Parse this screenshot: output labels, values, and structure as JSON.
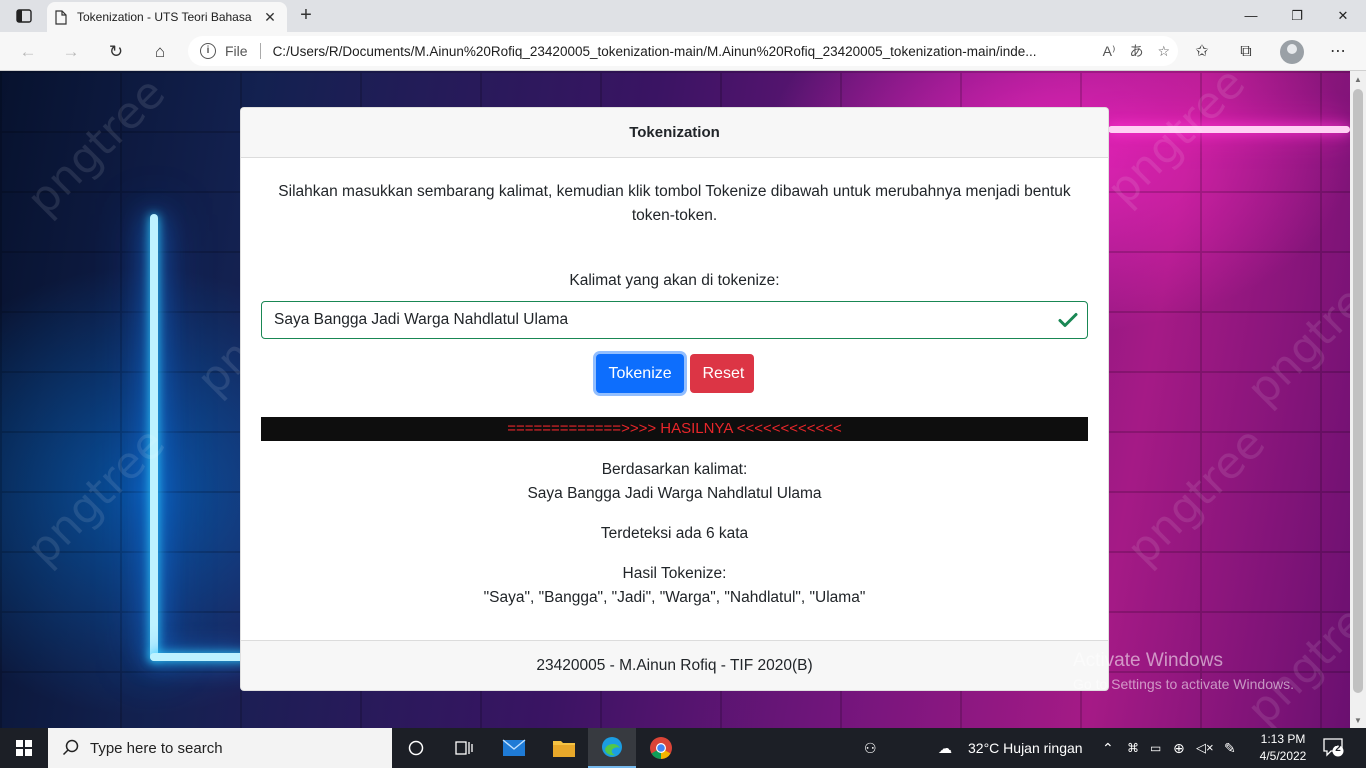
{
  "browser": {
    "tab_title": "Tokenization - UTS Teori Bahasa",
    "url_scheme_label": "File",
    "url": "C:/Users/R/Documents/M.Ainun%20Rofiq_23420005_tokenization-main/M.Ainun%20Rofiq_23420005_tokenization-main/inde..."
  },
  "card": {
    "title": "Tokenization",
    "intro": "Silahkan masukkan sembarang kalimat, kemudian klik tombol Tokenize dibawah untuk merubahnya menjadi bentuk token-token.",
    "input_label": "Kalimat yang akan di tokenize:",
    "input_value": "Saya Bangga Jadi Warga Nahdlatul Ulama",
    "tokenize_button": "Tokenize",
    "reset_button": "Reset",
    "result_header": "=============>>>> HASILNYA <<<<<<<<<<<<",
    "based_on_label": "Berdasarkan kalimat:",
    "based_on_value": "Saya Bangga Jadi Warga Nahdlatul Ulama",
    "detected": "Terdeteksi ada 6 kata",
    "tokens_label": "Hasil Tokenize:",
    "tokens_value": "\"Saya\", \"Bangga\", \"Jadi\", \"Warga\", \"Nahdlatul\", \"Ulama\"",
    "footer": "23420005 - M.Ainun Rofiq - TIF 2020(B)"
  },
  "background": {
    "watermark": "pngtree",
    "activate_title": "Activate Windows",
    "activate_subtitle": "Go to Settings to activate Windows."
  },
  "taskbar": {
    "search_placeholder": "Type here to search",
    "weather": "32°C  Hujan ringan",
    "time": "1:13 PM",
    "date": "4/5/2022",
    "notification_count": "2"
  },
  "colors": {
    "primary": "#0d6efd",
    "danger": "#dc3545",
    "success": "#198754",
    "result_text": "#e8262a"
  }
}
